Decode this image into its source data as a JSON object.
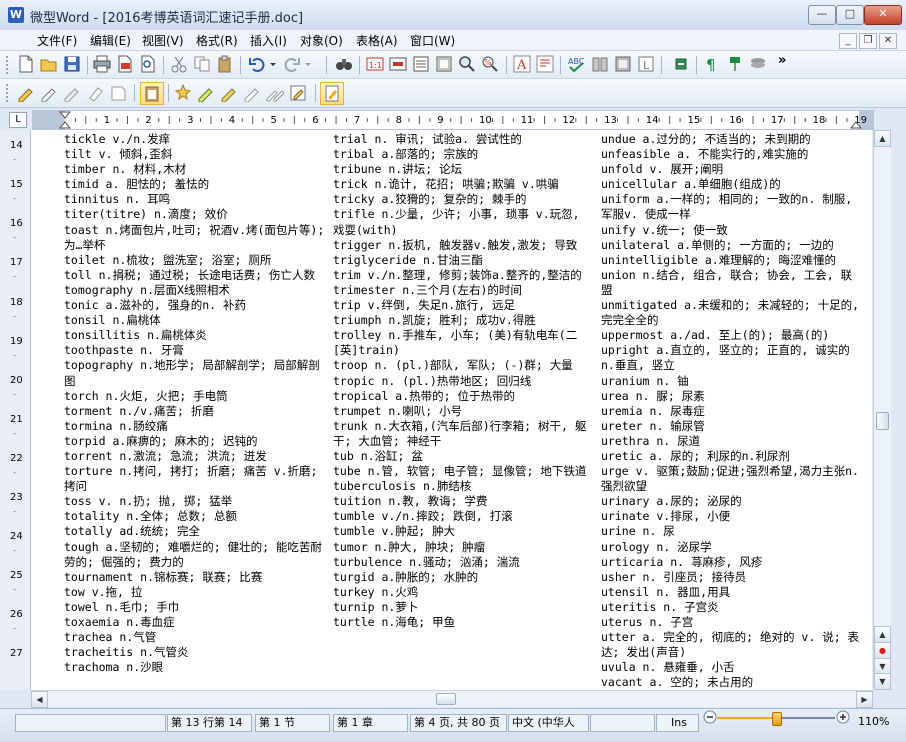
{
  "window": {
    "title": "微型Word - [2016考博英语词汇速记手册.doc]",
    "minimize_symbol": "—",
    "maximize_symbol": "□",
    "close_symbol": "✕"
  },
  "menubar": {
    "items": [
      "文件(F)",
      "编辑(E)",
      "视图(V)",
      "格式(R)",
      "插入(I)",
      "对象(O)",
      "表格(A)",
      "窗口(W)"
    ],
    "mdi_minimize": "_",
    "mdi_restore": "❐",
    "mdi_close": "✕"
  },
  "toolbar": {
    "overflow_label": "»"
  },
  "ruler": {
    "corner_label": "L",
    "ticks": [
      "1",
      "2",
      "3",
      "4",
      "5",
      "6",
      "7",
      "8",
      "9",
      "10",
      "11",
      "12",
      "13",
      "14",
      "15",
      "16",
      "17",
      "18",
      "19"
    ]
  },
  "vertical_ruler": {
    "numbers": [
      "14",
      "15",
      "16",
      "17",
      "18",
      "19",
      "20",
      "21",
      "22",
      "23",
      "24",
      "25",
      "26",
      "27"
    ]
  },
  "columns": {
    "col1": [
      "tickle v./n.发痒",
      "tilt v. 倾斜,歪斜",
      "timber n. 材料,木材",
      "timid a. 胆怯的; 羞怯的",
      "tinnitus n. 耳鸣",
      "titer(titre) n.滴度; 效价",
      "toast n.烤面包片,吐司; 祝酒v.烤(面包片等); 为…举杯",
      "toilet n.梳妆; 盥洗室; 浴室; 厕所",
      "toll n.捐税; 通过税; 长途电话费; 伤亡人数",
      "tomography n.层面X线照相术",
      "tonic a.滋补的, 强身的n. 补药",
      "tonsil n.扁桃体",
      "tonsillitis n.扁桃体炎",
      "toothpaste n. 牙膏",
      "topography n.地形学; 局部解剖学; 局部解剖图",
      "torch n.火炬, 火把; 手电筒",
      "torment n./v.痛苦; 折磨",
      "tormina n.肠绞痛",
      "torpid a.麻痹的; 麻木的; 迟钝的",
      "torrent n.激流; 急流; 洪流; 迸发",
      "torture n.拷问, 拷打; 折磨; 痛苦 v.折磨; 拷问",
      "toss v. n.扔; 抛, 掷; 猛举",
      "totality n.全体; 总数; 总额",
      "totally ad.统统; 完全",
      "tough a.坚韧的; 难嚼烂的; 健壮的; 能吃苦耐劳的; 倔强的; 费力的",
      "tournament n.锦标赛; 联赛; 比赛",
      "tow v.拖, 拉",
      "towel n.毛巾; 手巾",
      "toxaemia n.毒血症",
      "trachea n.气管",
      "tracheitis n.气管炎",
      "trachoma n.沙眼"
    ],
    "col2": [
      "trial n. 审讯; 试验a. 尝试性的",
      "tribal a.部落的; 宗族的",
      "tribune n.讲坛; 论坛",
      "trick n.诡计, 花招; 哄骗;欺骗 v.哄骗",
      "tricky a.狡猾的; 复杂的; 棘手的",
      "trifle n.少量, 少许; 小事, 琐事 v.玩忽, 戏耍(with)",
      "trigger n.扳机, 触发器v.触发,激发; 导致",
      "triglyceride n.甘油三酯",
      "trim v./n.整理, 修剪;装饰a.整齐的,整洁的",
      "trimester n.三个月(左右)的时间",
      "trip v.绊倒, 失足n.旅行, 远足",
      "triumph n.凯旋; 胜利; 成功v.得胜",
      "trolley n.手推车, 小车; (美)有轨电车(二[英]train)",
      "troop n. (pl.)部队, 军队; (-)群; 大量",
      "tropic n. (pl.)热带地区; 回归线",
      "tropical a.热带的; 位于热带的",
      "trumpet n.喇叭; 小号",
      "trunk n.大衣箱,(汽车后部)行李箱; 树干, 躯干; 大血管; 神经干",
      "tub n.浴缸; 盆",
      "tube n.管, 软管; 电子管; 显像管; 地下铁道",
      "tuberculosis n.肺结核",
      "tuition n.教, 教诲; 学费",
      "tumble v./n.摔跤; 跌倒, 打滚",
      "tumble v.肿起; 肿大",
      "tumor n.肿大, 肿块; 肿瘤",
      "turbulence n.骚动; 汹涌; 湍流",
      "turgid a.肿胀的; 水肿的",
      "turkey n.火鸡",
      "turnip n.萝卜",
      "turtle n.海龟; 甲鱼"
    ],
    "col3": [
      "undue a.过分的; 不适当的; 未到期的",
      "unfeasible a. 不能实行的,难实施的",
      "unfold v. 展开;阐明",
      "unicellular a.单细胞(组成)的",
      "uniform a.一样的; 相同的; 一致的n. 制服, 军服v. 使成一样",
      "unify v.统一; 使一致",
      "unilateral a.单侧的; 一方面的; 一边的",
      "unintelligible a.难理解的; 晦涩难懂的",
      "union n.结合, 组合, 联合; 协会, 工会, 联盟",
      "unmitigated a.未缓和的; 未减轻的; 十足的, 完完全全的",
      "uppermost a./ad. 至上(的); 最高(的)",
      "upright a.直立的, 竖立的; 正直的, 诚实的n.垂直, 竖立",
      "uranium n. 铀",
      "urea n. 脲; 尿素",
      "uremia n. 尿毒症",
      "ureter n. 输尿管",
      "urethra n. 尿道",
      "uretic a. 尿的; 利尿的n.利尿剂",
      "urge v. 驱策;鼓励;促进;强烈希望,渴力主张n.强烈欲望",
      "urinary a.尿的; 泌尿的",
      "urinate v.排尿, 小便",
      "urine n. 尿",
      "urology n. 泌尿学",
      "urticaria n. 荨麻疹, 风疹",
      "usher n. 引座员; 接待员",
      "utensil n. 器皿,用具",
      "uteritis n. 子宫炎",
      "uterus n. 子宫",
      "utter a. 完全的, 彻底的; 绝对的 v. 说; 表达; 发出(声音)",
      "uvula n. 悬雍垂, 小舌",
      "vacant a. 空的; 未占用的"
    ]
  },
  "statusbar": {
    "position": "第 13 行第 14",
    "section": "第 1 节",
    "chapter": "第 1 章",
    "page": "第 4 页, 共 80 页",
    "language": "中文 (中华人",
    "insert_mode": "Ins",
    "zoom": "110%",
    "zoom_level": 0.5
  }
}
